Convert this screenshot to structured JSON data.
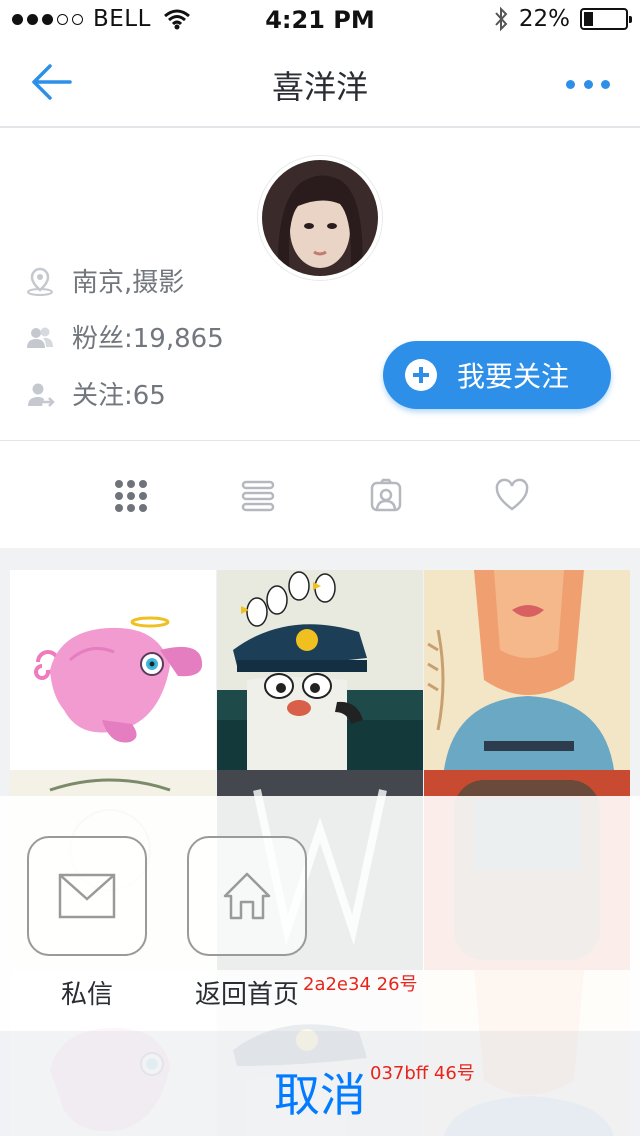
{
  "status_bar": {
    "carrier": "BELL",
    "time": "4:21 PM",
    "battery_text": "22%",
    "battery_level": 0.22
  },
  "nav": {
    "title": "喜洋洋",
    "back_icon": "arrow-left-icon",
    "more_icon": "more-dots-icon"
  },
  "profile": {
    "location": "南京,摄影",
    "fans": "粉丝:19,865",
    "following": "关注:65",
    "follow_button": "我要关注"
  },
  "tabs": [
    {
      "name": "grid-view-tab",
      "icon": "dots-grid-icon"
    },
    {
      "name": "list-view-tab",
      "icon": "list-icon"
    },
    {
      "name": "portrait-tab",
      "icon": "portrait-icon"
    },
    {
      "name": "favorites-tab",
      "icon": "heart-icon"
    }
  ],
  "action_sheet": {
    "message_label": "私信",
    "home_label": "返回首页",
    "cancel_label": "取消",
    "annotation_text": "2a2e34   26号",
    "annotation_cancel": "037bff   46号"
  },
  "colors": {
    "accent": "#2d8fe8",
    "text_dark": "#2a2e34",
    "text_muted": "#72777e",
    "cancel": "#037bff",
    "annotation": "#e8251c"
  }
}
